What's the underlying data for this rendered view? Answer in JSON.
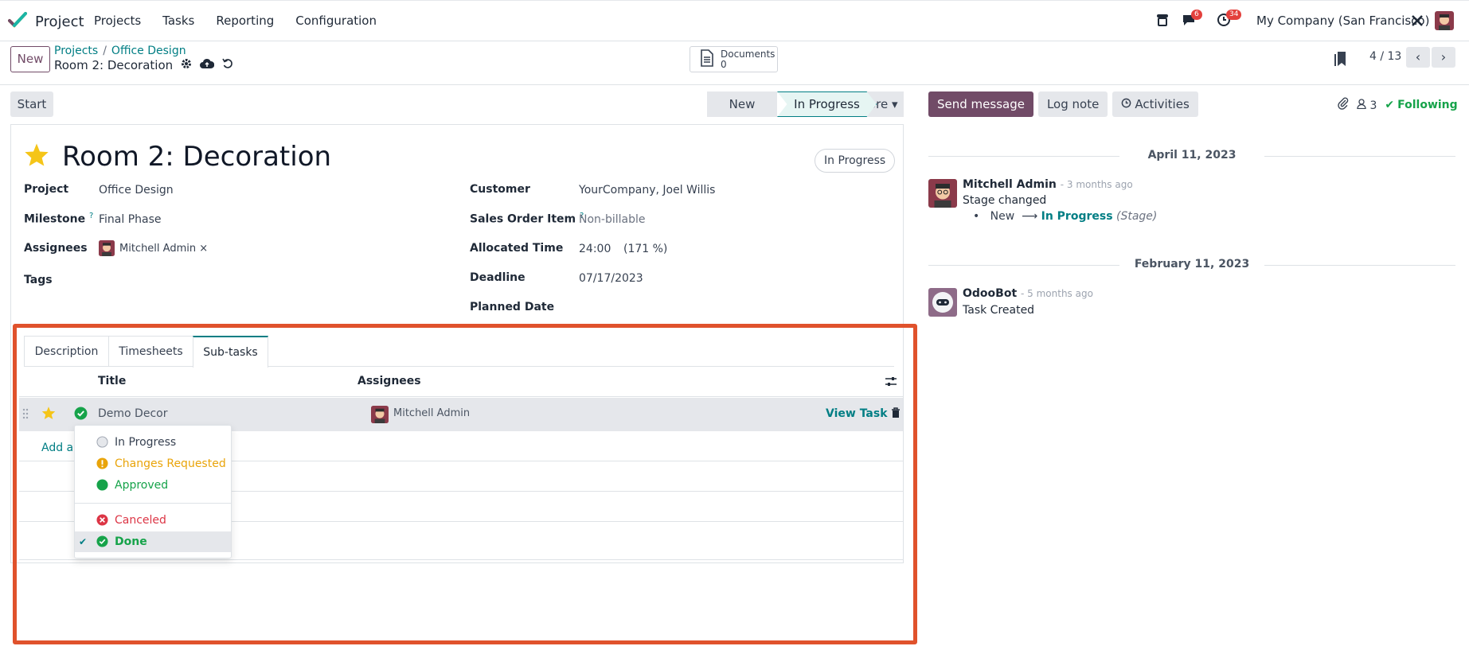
{
  "navbar": {
    "app_name": "Project",
    "menu": [
      "Projects",
      "Tasks",
      "Reporting",
      "Configuration"
    ],
    "messages_badge": "6",
    "activities_badge": "34",
    "company": "My Company (San Francisco)"
  },
  "control_panel": {
    "new_label": "New",
    "breadcrumb": [
      "Projects",
      "Office Design"
    ],
    "record_name": "Room 2: Decoration",
    "documents_label": "Documents",
    "documents_count": "0",
    "pager": "4 / 13"
  },
  "statusbar": {
    "start_label": "Start",
    "stages": [
      "New",
      "In Progress",
      "More"
    ],
    "current_stage": "In Progress"
  },
  "form": {
    "title": "Room 2: Decoration",
    "stage_pill": "In Progress",
    "left_fields": [
      {
        "label": "Project",
        "value": "Office Design"
      },
      {
        "label": "Milestone",
        "value": "Final Phase"
      },
      {
        "label": "Assignees",
        "value": "Mitchell Admin"
      },
      {
        "label": "Tags",
        "value": ""
      }
    ],
    "right_fields": [
      {
        "label": "Customer",
        "value": "YourCompany, Joel Willis"
      },
      {
        "label": "Sales Order Item",
        "value": "Non-billable"
      },
      {
        "label": "Allocated Time",
        "value": "24:00",
        "extra": "(171 %)"
      },
      {
        "label": "Deadline",
        "value": "07/17/2023"
      },
      {
        "label": "Planned Date",
        "value": ""
      }
    ],
    "help_mark": "?",
    "remove_mark": "×"
  },
  "notebook": {
    "tabs": [
      "Description",
      "Timesheets",
      "Sub-tasks"
    ],
    "active_tab": "Sub-tasks",
    "columns": [
      "Title",
      "Assignees"
    ],
    "rows": [
      {
        "title": "Demo Decor",
        "assignee": "Mitchell Admin",
        "action": "View Task"
      }
    ],
    "add_line": "Add a"
  },
  "status_dropdown": {
    "items": [
      {
        "label": "In Progress",
        "color": "#9ca3af"
      },
      {
        "label": "Changes Requested",
        "color": "#e9a40a"
      },
      {
        "label": "Approved",
        "color": "#16a34a"
      },
      {
        "label": "Canceled",
        "color": "#dc3545"
      },
      {
        "label": "Done",
        "color": "#16a34a"
      }
    ],
    "selected": "Done"
  },
  "chatter": {
    "send_message": "Send message",
    "log_note": "Log note",
    "activities": "Activities",
    "followers_count": "3",
    "following": "Following",
    "groups": [
      {
        "date": "April 11, 2023",
        "author": "Mitchell Admin",
        "ago": "- 3 months ago",
        "body": "Stage changed",
        "old_value": "New",
        "new_value": "In Progress",
        "field": "(Stage)"
      },
      {
        "date": "February 11, 2023",
        "author": "OdooBot",
        "ago": "- 5 months ago",
        "body": "Task Created"
      }
    ]
  },
  "colors": {
    "brand": "#714b67",
    "accent": "#017e84",
    "highlight": "#e0522c"
  }
}
